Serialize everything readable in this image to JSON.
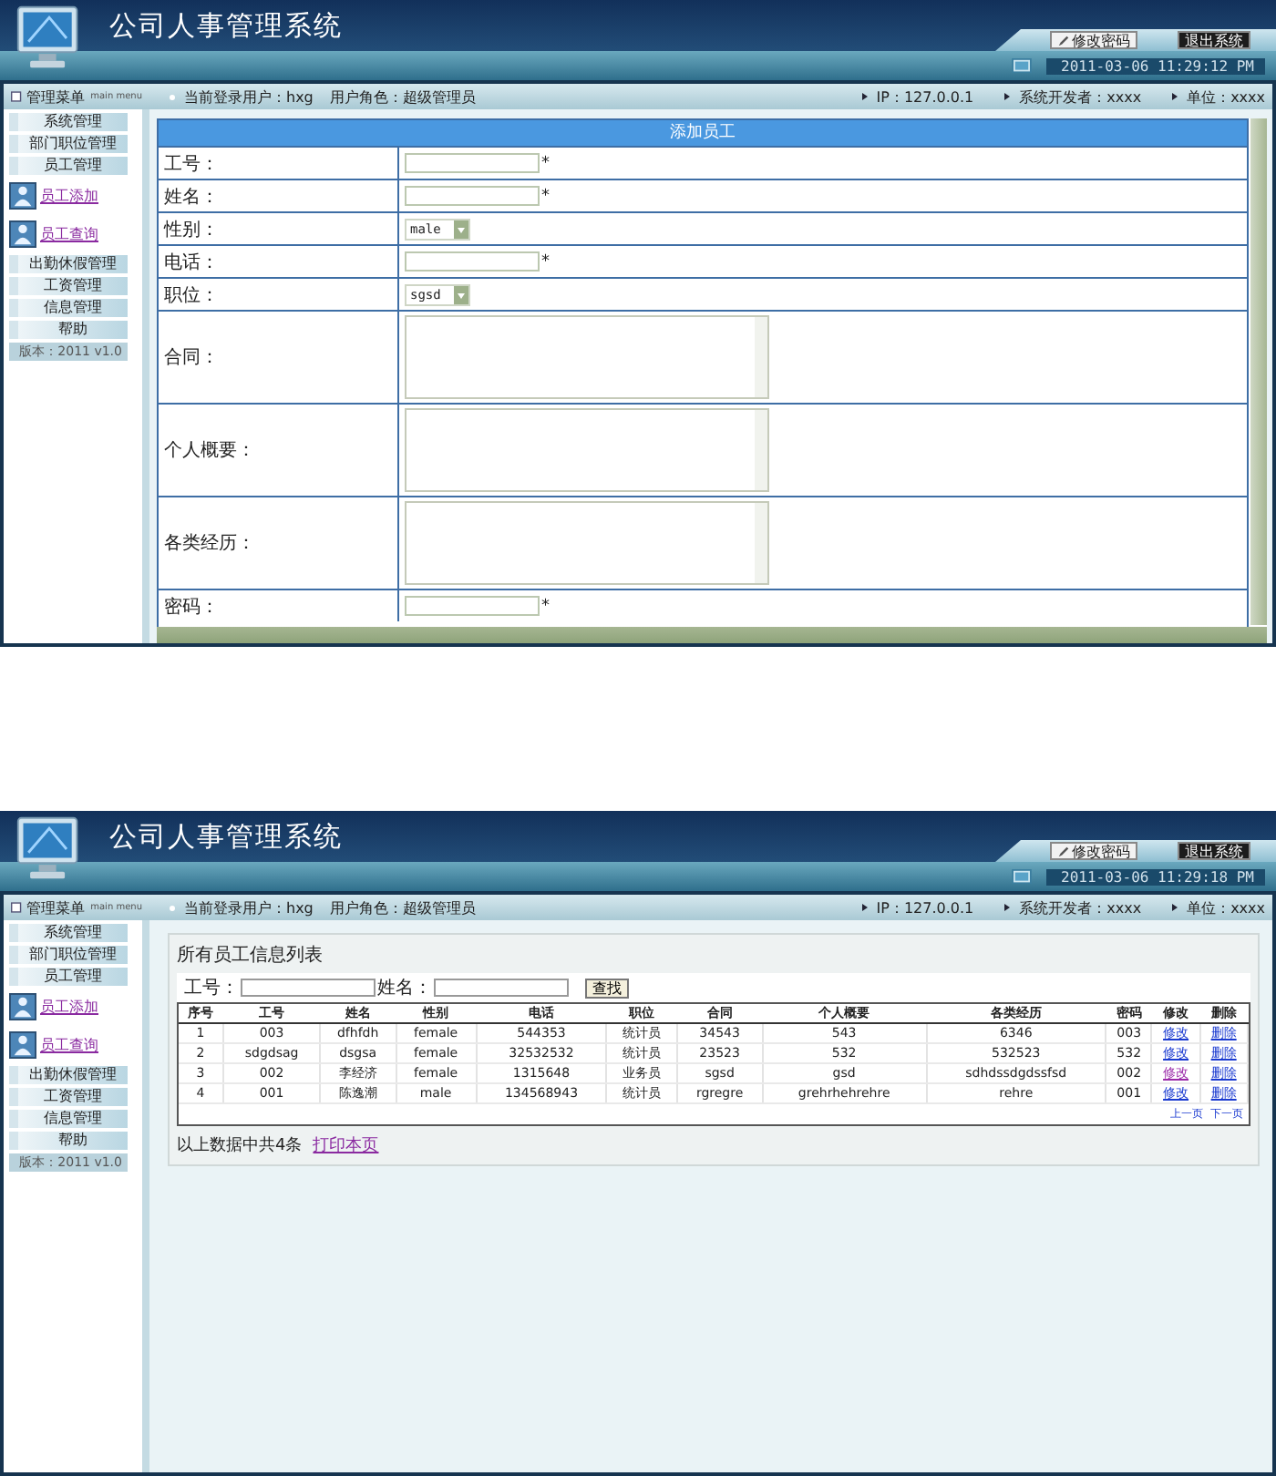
{
  "screens": [
    {
      "header": {
        "title": "公司人事管理系统",
        "buttons": [
          {
            "label": "修改密码",
            "kind": "edit"
          },
          {
            "label": "退出系统",
            "kind": "exit"
          }
        ],
        "datetime": "2011-03-06 11:29:12 PM"
      },
      "info_bar": {
        "menu_title": "管理菜单",
        "menu_subtitle": "main menu",
        "user": "当前登录用户：hxg",
        "role": "用户角色：超级管理员",
        "items": [
          "IP：127.0.0.1",
          "系统开发者：xxxx",
          "单位：xxxx"
        ]
      },
      "sidebar": {
        "items": [
          {
            "label": "系统管理",
            "kind": "menu"
          },
          {
            "label": "部门职位管理",
            "kind": "menu"
          },
          {
            "label": "员工管理",
            "kind": "menu"
          },
          {
            "label": "员工添加",
            "kind": "link"
          },
          {
            "label": "员工查询",
            "kind": "link"
          },
          {
            "label": "出勤休假管理",
            "kind": "menu"
          },
          {
            "label": "工资管理",
            "kind": "menu"
          },
          {
            "label": "信息管理",
            "kind": "menu"
          },
          {
            "label": "帮助",
            "kind": "menu"
          }
        ],
        "version": "版本：2011 v1.0"
      },
      "content": {
        "kind": "form",
        "title": "添加员工",
        "fields": [
          {
            "label": "工号：",
            "kind": "text",
            "mark": "*"
          },
          {
            "label": "姓名：",
            "kind": "text",
            "mark": "*"
          },
          {
            "label": "性别：",
            "kind": "select",
            "value": "male"
          },
          {
            "label": "电话：",
            "kind": "text",
            "mark": "*"
          },
          {
            "label": "职位：",
            "kind": "select",
            "value": "sgsd"
          },
          {
            "label": "合同：",
            "kind": "textarea"
          },
          {
            "label": "个人概要：",
            "kind": "textarea"
          },
          {
            "label": "各类经历：",
            "kind": "textarea"
          },
          {
            "label": "密码：",
            "kind": "text",
            "mark": "*"
          }
        ]
      }
    },
    {
      "header": {
        "title": "公司人事管理系统",
        "buttons": [
          {
            "label": "修改密码",
            "kind": "edit"
          },
          {
            "label": "退出系统",
            "kind": "exit"
          }
        ],
        "datetime": "2011-03-06 11:29:18 PM"
      },
      "info_bar": {
        "menu_title": "管理菜单",
        "menu_subtitle": "main menu",
        "user": "当前登录用户：hxg",
        "role": "用户角色：超级管理员",
        "items": [
          "IP：127.0.0.1",
          "系统开发者：xxxx",
          "单位：xxxx"
        ]
      },
      "sidebar": {
        "items": [
          {
            "label": "系统管理",
            "kind": "menu"
          },
          {
            "label": "部门职位管理",
            "kind": "menu"
          },
          {
            "label": "员工管理",
            "kind": "menu"
          },
          {
            "label": "员工添加",
            "kind": "link"
          },
          {
            "label": "员工查询",
            "kind": "link"
          },
          {
            "label": "出勤休假管理",
            "kind": "menu"
          },
          {
            "label": "工资管理",
            "kind": "menu"
          },
          {
            "label": "信息管理",
            "kind": "menu"
          },
          {
            "label": "帮助",
            "kind": "menu"
          }
        ],
        "version": "版本：2011 v1.0"
      },
      "content": {
        "kind": "list",
        "title": "所有员工信息列表",
        "search": {
          "fields": [
            "工号：",
            "姓名："
          ],
          "button": "查找"
        },
        "table": {
          "columns": [
            "序号",
            "工号",
            "姓名",
            "性别",
            "电话",
            "职位",
            "合同",
            "个人概要",
            "各类经历",
            "密码",
            "修改",
            "删除"
          ],
          "rows": [
            {
              "cells": [
                "1",
                "003",
                "dfhfdh",
                "female",
                "544353",
                "统计员",
                "34543",
                "543",
                "6346",
                "003"
              ],
              "actions": [
                {
                  "label": "修改",
                  "visited": false
                },
                {
                  "label": "删除",
                  "visited": false
                }
              ]
            },
            {
              "cells": [
                "2",
                "sdgdsag",
                "dsgsa",
                "female",
                "32532532",
                "统计员",
                "23523",
                "532",
                "532523",
                "532"
              ],
              "actions": [
                {
                  "label": "修改",
                  "visited": false
                },
                {
                  "label": "删除",
                  "visited": false
                }
              ]
            },
            {
              "cells": [
                "3",
                "002",
                "李经济",
                "female",
                "1315648",
                "业务员",
                "sgsd",
                "gsd",
                "sdhdssdgdssfsd",
                "002"
              ],
              "actions": [
                {
                  "label": "修改",
                  "visited": true
                },
                {
                  "label": "删除",
                  "visited": false
                }
              ]
            },
            {
              "cells": [
                "4",
                "001",
                "陈逸潮",
                "male",
                "134568943",
                "统计员",
                "rgregre",
                "grehrhehrehre",
                "rehre",
                "001"
              ],
              "actions": [
                {
                  "label": "修改",
                  "visited": false
                },
                {
                  "label": "删除",
                  "visited": false
                }
              ]
            }
          ]
        },
        "pager": [
          "上一页",
          "下一页"
        ],
        "summary": "以上数据中共4条",
        "print_link": "打印本页"
      }
    }
  ]
}
